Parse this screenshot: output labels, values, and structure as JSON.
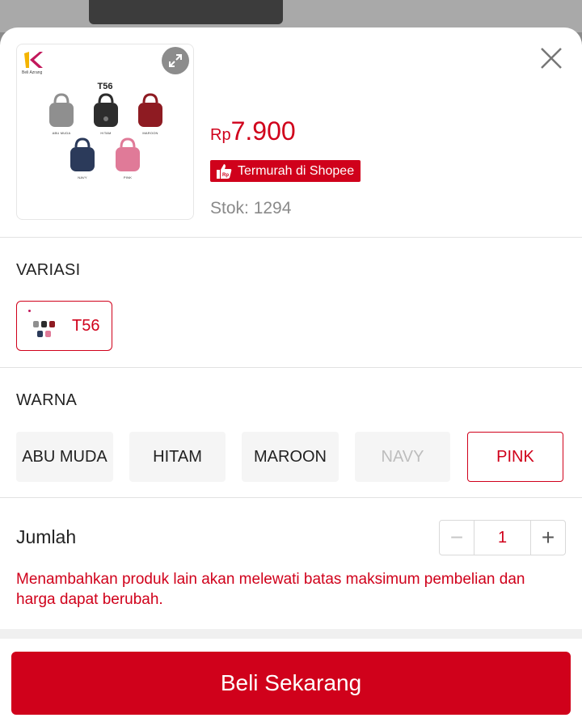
{
  "product": {
    "image": {
      "logo_text": "K",
      "logo_subtext": "Beli Azrang",
      "code": "T56",
      "bags": [
        {
          "caption": "ABU MUDA",
          "color": "#8f8f8f"
        },
        {
          "caption": "HITAM",
          "color": "#2d2d2d"
        },
        {
          "caption": "MAROON",
          "color": "#8e1b22"
        },
        {
          "caption": "NAVY",
          "color": "#2b3a5a"
        },
        {
          "caption": "PINK",
          "color": "#e07a98"
        }
      ]
    },
    "price_currency": "Rp",
    "price_amount": "7.900",
    "badge_label": "Termurah di Shopee",
    "stock_label": "Stok: 1294"
  },
  "variasi": {
    "title": "VARIASI",
    "options": [
      {
        "label": "T56",
        "selected": true
      }
    ]
  },
  "warna": {
    "title": "WARNA",
    "options": [
      {
        "label": "ABU MUDA",
        "state": "default"
      },
      {
        "label": "HITAM",
        "state": "default"
      },
      {
        "label": "MAROON",
        "state": "default"
      },
      {
        "label": "NAVY",
        "state": "disabled"
      },
      {
        "label": "PINK",
        "state": "selected"
      }
    ]
  },
  "quantity": {
    "label": "Jumlah",
    "minus": "−",
    "value": "1",
    "plus": "+"
  },
  "warning_text": "Menambahkan produk lain akan melewati batas maksimum pembelian dan harga dapat berubah.",
  "buy_button_label": "Beli Sekarang",
  "colors": {
    "accent": "#d0011b",
    "chip_bg": "#f5f5f5",
    "muted_text": "#8a8a8a"
  },
  "icons": {
    "close": "close-icon",
    "expand": "expand-icon",
    "badge": "thumbs-up-icon"
  }
}
